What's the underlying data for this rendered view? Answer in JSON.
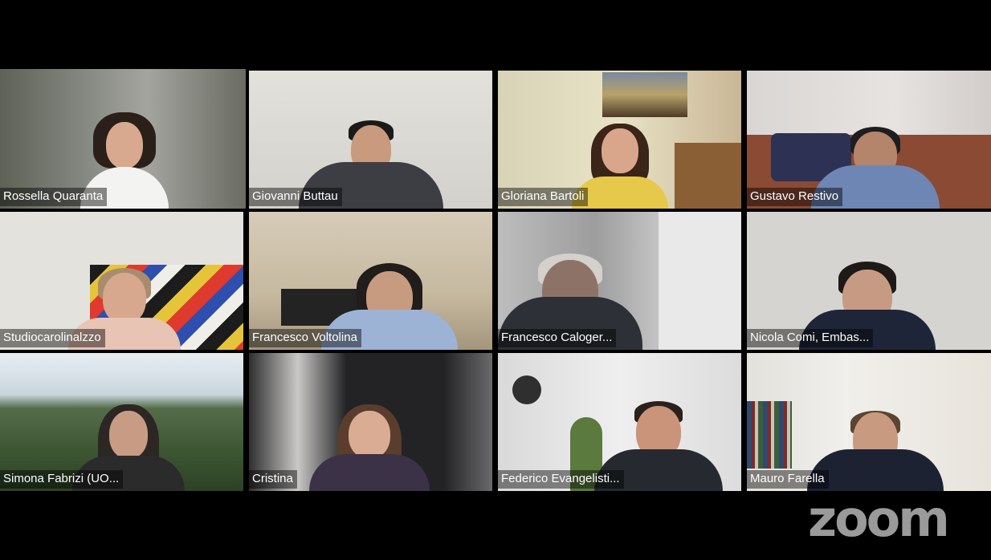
{
  "meeting": {
    "app": "zoom",
    "active_speaker": "Rossella Quaranta"
  },
  "participants": [
    {
      "name": "Rossella Quaranta"
    },
    {
      "name": "Giovanni Buttau"
    },
    {
      "name": "Gloriana Bartoli"
    },
    {
      "name": "Gustavo Restivo"
    },
    {
      "name": "Studiocarolinalzzo"
    },
    {
      "name": "Francesco Voltolina"
    },
    {
      "name": "Francesco Caloger..."
    },
    {
      "name": "Nicola Comi, Embas..."
    },
    {
      "name": "Simona Fabrizi (UO..."
    },
    {
      "name": "Cristina"
    },
    {
      "name": "Federico Evangelisti..."
    },
    {
      "name": "Mauro Farella"
    }
  ],
  "colors": {
    "active_speaker_border": "#5ce04b",
    "background": "#000000",
    "label_text": "#ffffff",
    "logo": "#9a9a9a"
  }
}
